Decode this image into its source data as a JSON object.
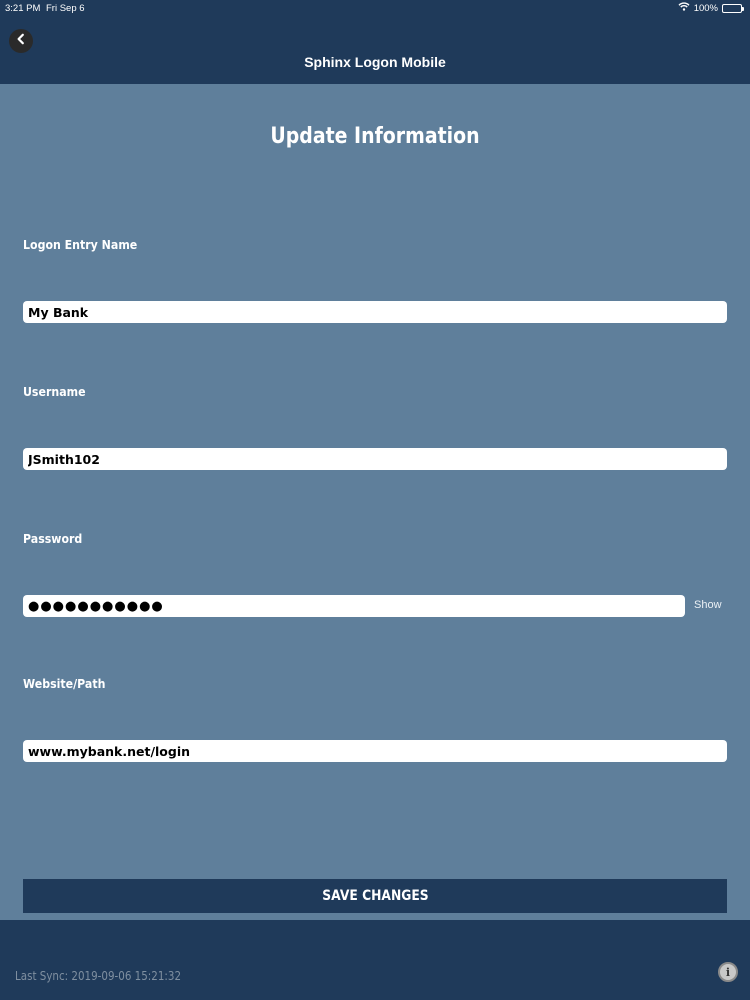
{
  "status_bar": {
    "time": "3:21 PM",
    "date": "Fri Sep 6",
    "battery": "100%"
  },
  "nav": {
    "title": "Sphinx Logon Mobile",
    "back_icon": "chevron-left-icon"
  },
  "page": {
    "title": "Update Information"
  },
  "form": {
    "entry_name": {
      "label": "Logon Entry Name",
      "value": "My Bank"
    },
    "username": {
      "label": "Username",
      "value": "JSmith102"
    },
    "password": {
      "label": "Password",
      "value": "●●●●●●●●●●●",
      "show_label": "Show"
    },
    "website": {
      "label": "Website/Path",
      "value": "www.mybank.net/login"
    }
  },
  "save_button": {
    "label": "SAVE CHANGES"
  },
  "footer": {
    "last_sync": "Last Sync: 2019-09-06 15:21:32",
    "info_icon": "info-icon"
  },
  "colors": {
    "header": "#1f3a5a",
    "background": "#5f7f9b",
    "field": "#ffffff",
    "text_light": "#ffffff"
  }
}
